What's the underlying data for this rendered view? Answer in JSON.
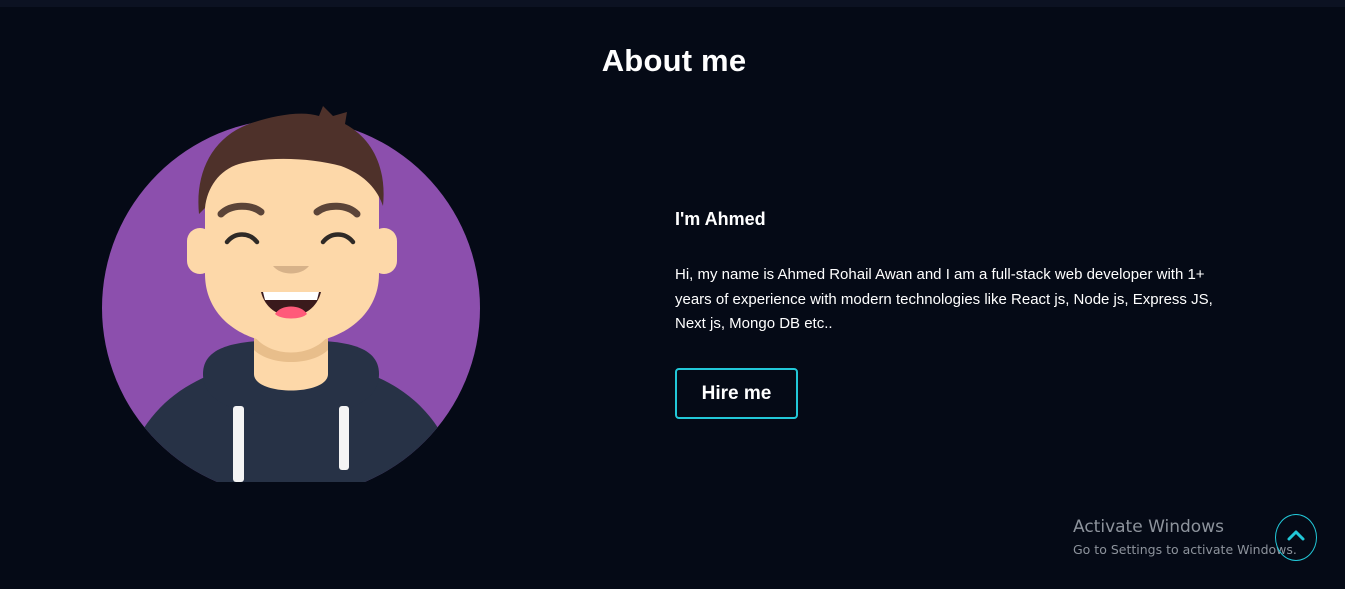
{
  "about": {
    "title": "About me",
    "greeting": "I'm Ahmed",
    "bio": "Hi, my name is Ahmed Rohail Awan and I am a full-stack web developer with 1+ years of experience with modern technologies like React js, Node js, Express JS, Next js, Mongo DB etc..",
    "hire_label": "Hire me"
  },
  "watermark": {
    "title": "Activate Windows",
    "subtitle": "Go to Settings to activate Windows."
  },
  "colors": {
    "background": "#050a16",
    "accent": "#22c8d8",
    "avatar_circle": "#8c4fad"
  },
  "icons": {
    "scroll_top": "chevron-up-icon"
  }
}
